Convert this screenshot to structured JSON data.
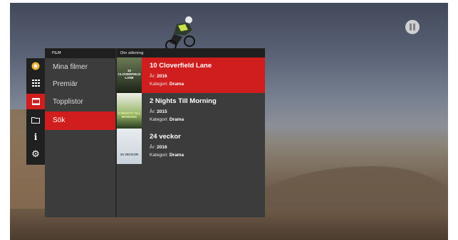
{
  "panels": {
    "film_header": "FILM",
    "search_header": "Din sökning"
  },
  "menu": {
    "items": [
      "Mina filmer",
      "Premiär",
      "Topplistor",
      "Sök"
    ],
    "active_index": 3
  },
  "sidebar": {
    "icons": [
      "flower-icon",
      "grid-icon",
      "film-icon",
      "folder-icon",
      "info-icon",
      "gear-icon"
    ],
    "active_index": 2
  },
  "results": [
    {
      "title": "10 Cloverfield Lane",
      "year_label": "År:",
      "year": "2016",
      "category_label": "Kategori:",
      "category": "Drama",
      "poster_text": "10 CLOVERFIELD LANE"
    },
    {
      "title": "2 Nights Till Morning",
      "year_label": "År:",
      "year": "2015",
      "category_label": "Kategori:",
      "category": "Drama",
      "poster_text": "2 NIGHTS TILL MORNING"
    },
    {
      "title": "24 veckor",
      "year_label": "År:",
      "year": "2016",
      "category_label": "Kategori:",
      "category": "Drama",
      "poster_text": "24 VECKOR"
    }
  ],
  "colors": {
    "accent": "#d01e1e",
    "panel": "#3c3c3c",
    "header": "#1f1f1f"
  }
}
